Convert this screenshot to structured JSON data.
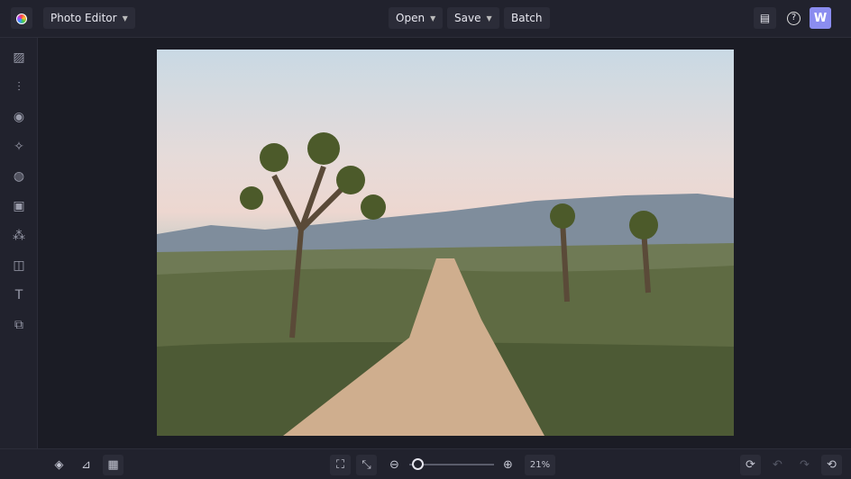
{
  "header": {
    "app_menu": "Photo Editor",
    "open": "Open",
    "save": "Save",
    "batch": "Batch",
    "avatar_initial": "W"
  },
  "sidebar": [
    "image-icon",
    "adjust-icon",
    "effects-icon",
    "sparkle-icon",
    "artsy-icon",
    "frames-icon",
    "graphics-icon",
    "overlays-icon",
    "text-icon",
    "textures-icon"
  ],
  "footer": {
    "zoom_percent": "21%",
    "zoom_level": 0.05
  },
  "colors": {
    "accent": "#8b8df0",
    "bg": "#1b1c25"
  }
}
